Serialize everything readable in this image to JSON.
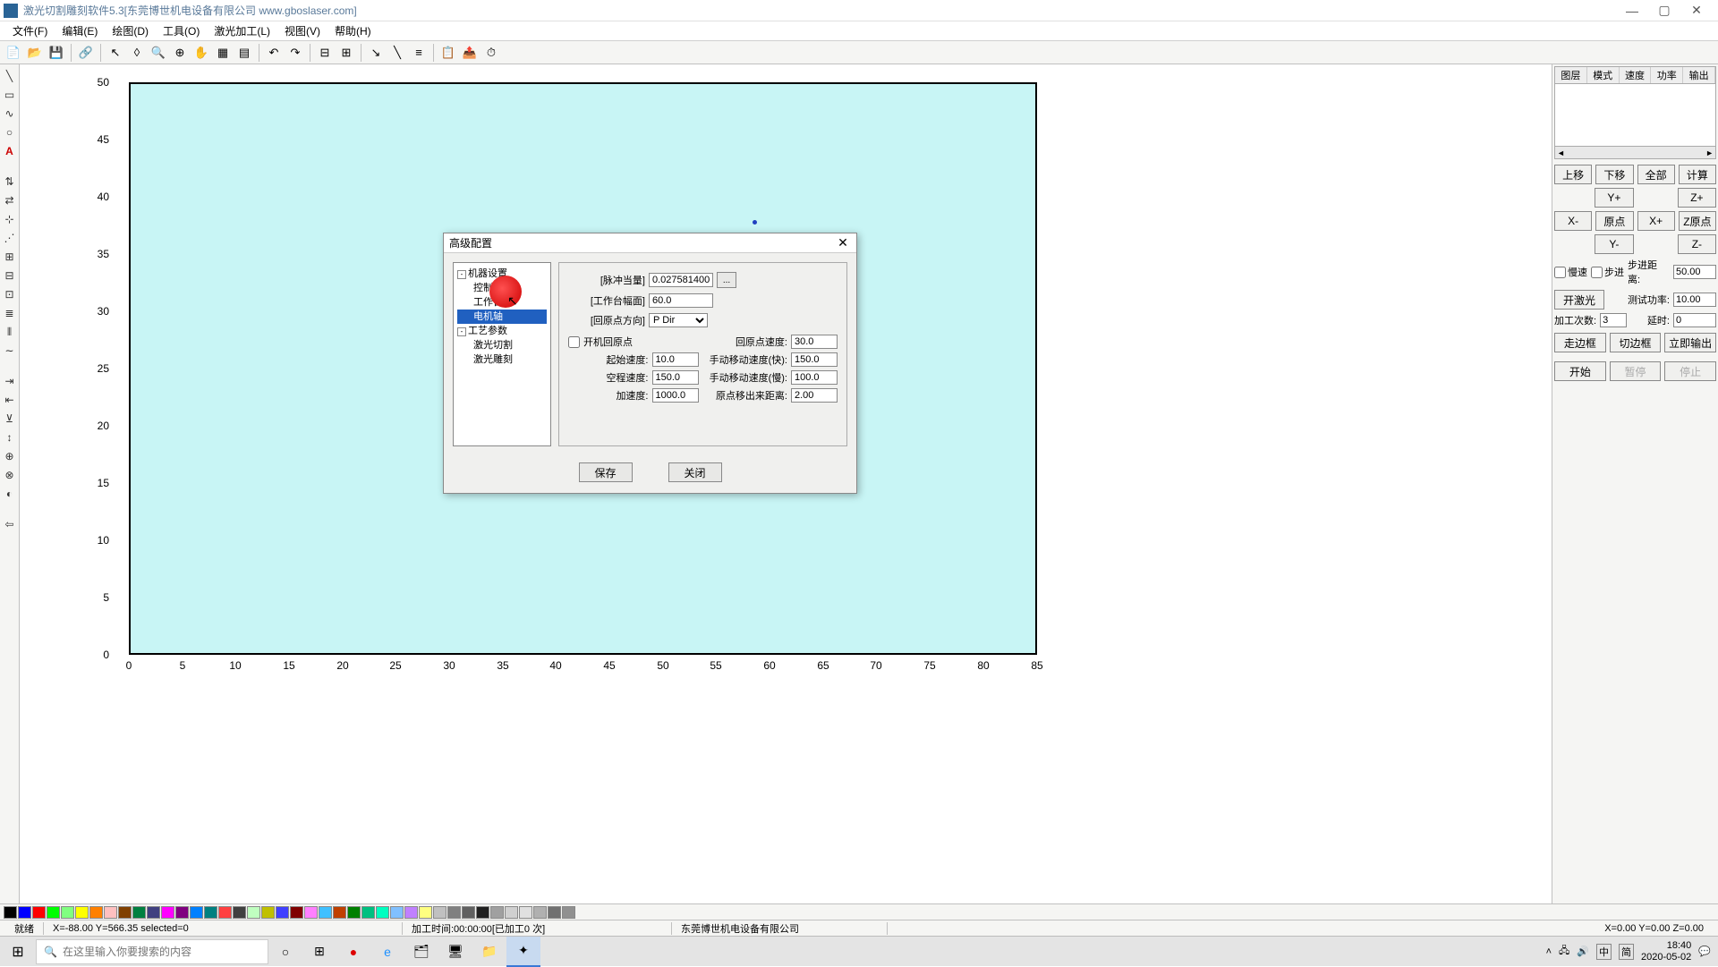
{
  "app": {
    "title": "激光切割雕刻软件5.3[东莞博世机电设备有限公司 www.gboslaser.com]"
  },
  "menu": {
    "file": "文件(F)",
    "edit": "编辑(E)",
    "draw": "绘图(D)",
    "tool": "工具(O)",
    "laser": "激光加工(L)",
    "view": "视图(V)",
    "help": "帮助(H)"
  },
  "right": {
    "col1": "图层",
    "col2": "模式",
    "col3": "速度",
    "col4": "功率",
    "col5": "输出",
    "up": "上移",
    "down": "下移",
    "all": "全部",
    "calc": "计算",
    "yplus": "Y+",
    "zplus": "Z+",
    "xminus": "X-",
    "origin": "原点",
    "xplus": "X+",
    "zorigin": "Z原点",
    "yminus": "Y-",
    "zminus": "Z-",
    "slow": "慢速",
    "step": "步进",
    "stepdist_label": "步进距离:",
    "stepdist": "50.00",
    "laser_on": "开激光",
    "testpower_label": "测试功率:",
    "testpower": "10.00",
    "count_label": "加工次数:",
    "count": "3",
    "delay_label": "延时:",
    "delay": "0",
    "walk": "走边框",
    "cut": "切边框",
    "output": "立即输出",
    "start": "开始",
    "pause": "暂停",
    "stop": "停止"
  },
  "dialog": {
    "title": "高级配置",
    "tree": {
      "root1": "机器设置",
      "c1": "控制卡",
      "c2": "工作台",
      "c3": "电机轴",
      "root2": "工艺参数",
      "c4": "激光切割",
      "c5": "激光雕刻"
    },
    "pulse_label": "[脉冲当量]",
    "pulse": "0.0275814000",
    "pulse_btn": "...",
    "width_label": "[工作台幅面]",
    "width": "60.0",
    "dir_label": "[回原点方向]",
    "dir": "P Dir",
    "homecheck": "开机回原点",
    "homespeed_label": "回原点速度:",
    "homespeed": "30.0",
    "startspeed_label": "起始速度:",
    "startspeed": "10.0",
    "fastspeed_label": "手动移动速度(快):",
    "fastspeed": "150.0",
    "idlespeed_label": "空程速度:",
    "idlespeed": "150.0",
    "slowspeed_label": "手动移动速度(慢):",
    "slowspeed": "100.0",
    "accel_label": "加速度:",
    "accel": "1000.0",
    "offset_label": "原点移出来距离:",
    "offset": "2.00",
    "save": "保存",
    "close": "关闭"
  },
  "chart_data": {
    "type": "scatter",
    "x_range": [
      0,
      85
    ],
    "y_range": [
      0,
      50
    ],
    "x_ticks": [
      0,
      5,
      10,
      15,
      20,
      25,
      30,
      35,
      40,
      45,
      50,
      55,
      60,
      65,
      70,
      75,
      80,
      85
    ],
    "y_ticks": [
      0,
      5,
      10,
      15,
      20,
      25,
      30,
      35,
      40,
      45,
      50
    ],
    "points": [
      {
        "x": 59,
        "y": 38
      }
    ]
  },
  "palette": [
    "#000000",
    "#0000ff",
    "#ff0000",
    "#00ff00",
    "#80ff80",
    "#ffff00",
    "#ff8000",
    "#ffc0c0",
    "#804000",
    "#008040",
    "#404080",
    "#ff00ff",
    "#800080",
    "#0080ff",
    "#008080",
    "#ff4040",
    "#404040",
    "#c0ffc0",
    "#c0c000",
    "#4040ff",
    "#800000",
    "#ff80ff",
    "#40c0ff",
    "#c04000",
    "#008000",
    "#00c080",
    "#00ffc0",
    "#80c0ff",
    "#c080ff",
    "#ffff80",
    "#c0c0c0",
    "#808080",
    "#606060",
    "#202020",
    "#a0a0a0",
    "#d0d0d0",
    "#e0e0e0",
    "#b0b0b0",
    "#707070",
    "#909090"
  ],
  "status": {
    "ready": "就绪",
    "coords": "X=-88.00 Y=566.35 selected=0",
    "worktime": "加工时间:00:00:00[已加工0 次]",
    "company": "东莞博世机电设备有限公司",
    "xyz": "X=0.00 Y=0.00 Z=0.00"
  },
  "taskbar": {
    "search_placeholder": "在这里输入你要搜索的内容",
    "ime": "中",
    "ime2": "简",
    "time": "18:40",
    "date": "2020-05-02"
  }
}
